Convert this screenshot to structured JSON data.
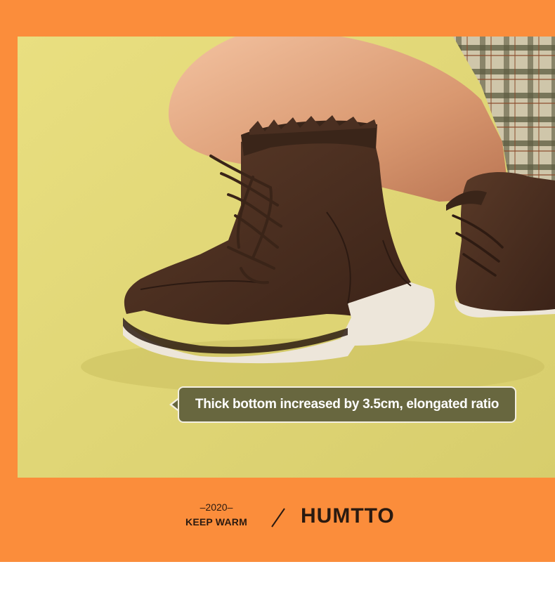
{
  "callout": {
    "text": "Thick bottom increased by 3.5cm, elongated ratio"
  },
  "footer": {
    "year": "–2020–",
    "tagline": "KEEP WARM",
    "brand": "HUMTTO"
  },
  "colors": {
    "banner": "#fb8d3b",
    "photo_background": "#e3d774",
    "boot_suede": "#4a2d20",
    "sole": "#ede6da",
    "callout_background": "#68673f",
    "text_dark": "#2a1a10"
  },
  "icons": {
    "divider": "slash-divider-icon"
  }
}
